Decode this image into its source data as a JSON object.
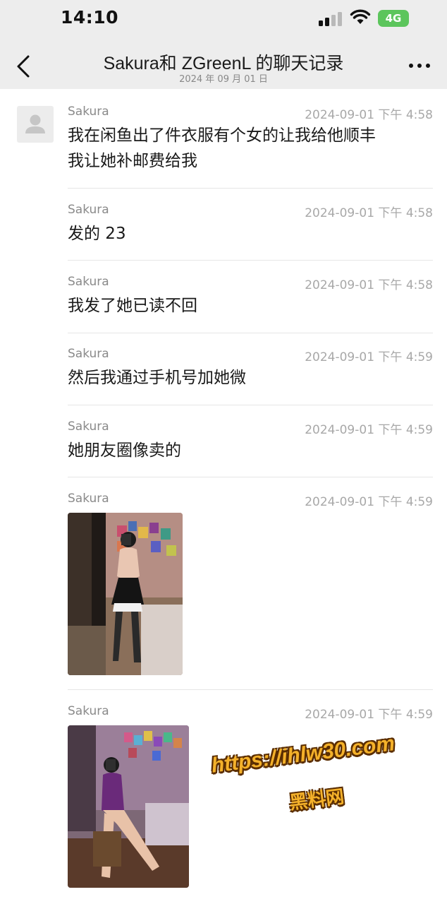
{
  "status_bar": {
    "time": "14:10",
    "network": "4G"
  },
  "nav": {
    "title": "Sakura和 ZGreenL 的聊天记录",
    "subtitle": "2024 年 09 月 01 日"
  },
  "messages": [
    {
      "sender": "Sakura",
      "time": "2024-09-01 下午 4:58",
      "text": "我在闲鱼出了件衣服有个女的让我给他顺丰\n我让她补邮费给我"
    },
    {
      "sender": "Sakura",
      "time": "2024-09-01 下午 4:58",
      "text": "发的 23"
    },
    {
      "sender": "Sakura",
      "time": "2024-09-01 下午 4:58",
      "text": "我发了她已读不回"
    },
    {
      "sender": "Sakura",
      "time": "2024-09-01 下午 4:59",
      "text": "然后我通过手机号加她微"
    },
    {
      "sender": "Sakura",
      "time": "2024-09-01 下午 4:59",
      "text": "她朋友圈像卖的"
    },
    {
      "sender": "Sakura",
      "time": "2024-09-01 下午 4:59",
      "image": "photo-1"
    },
    {
      "sender": "Sakura",
      "time": "2024-09-01 下午 4:59",
      "image": "photo-2"
    }
  ],
  "watermark": {
    "url": "https://ihlw30.com",
    "name": "黑料网"
  },
  "colors": {
    "header_bg": "#ededed",
    "network_badge": "#5cc55c",
    "watermark": "#f4b12a"
  }
}
